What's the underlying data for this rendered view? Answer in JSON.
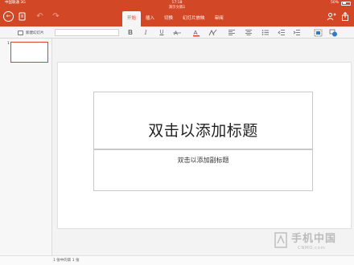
{
  "status_bar": {
    "carrier": "中国联通 3G",
    "time": "17:18",
    "battery": "50%"
  },
  "document": {
    "title": "演示文稿1"
  },
  "tabs": [
    {
      "label": "开始",
      "active": true
    },
    {
      "label": "插入",
      "active": false
    },
    {
      "label": "切换",
      "active": false
    },
    {
      "label": "幻灯片放映",
      "active": false
    },
    {
      "label": "审阅",
      "active": false
    }
  ],
  "ribbon": {
    "new_slide_label": "新建幻灯片",
    "font_name": ""
  },
  "slides": [
    {
      "number": "1",
      "selected": true
    }
  ],
  "slide": {
    "title_placeholder": "双击以添加标题",
    "subtitle_placeholder": "双击以添加副标题"
  },
  "footer": {
    "status": "1 张中的第 1 张"
  },
  "watermark": {
    "text": "手机中国",
    "subtext": "CNMO.com"
  },
  "colors": {
    "accent": "#d24726",
    "ribbon_bg": "#f5f5f5",
    "slide_bg": "#ffffff"
  },
  "icons": {
    "back": "back-arrow-icon",
    "document": "document-icon",
    "undo": "undo-icon",
    "redo": "redo-icon",
    "share": "share-icon",
    "add_person": "add-person-icon",
    "share_up": "share-upload-icon"
  }
}
